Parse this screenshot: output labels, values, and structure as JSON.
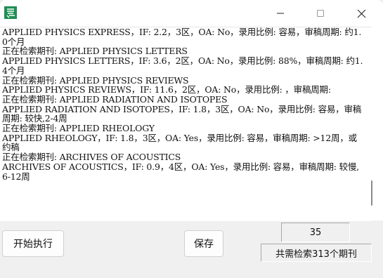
{
  "window": {
    "icon": "app-icon",
    "minimize_icon": "minimize-icon",
    "maximize_icon": "maximize-icon",
    "close_icon": "close-icon"
  },
  "log": {
    "lines": [
      "APPLIED PHYSICS EXPRESS，IF: 2.2，3区，OA: No，录用比例: 容易，审稿周期: 约1.0个月",
      "正在检索期刊: APPLIED PHYSICS LETTERS",
      "APPLIED PHYSICS LETTERS，IF: 3.6，2区，OA: No，录用比例: 88%，审稿周期: 约1.4个月",
      "正在检索期刊: APPLIED PHYSICS REVIEWS",
      "APPLIED PHYSICS REVIEWS，IF: 11.6，2区，OA: No，录用比例: ，审稿周期:",
      "正在检索期刊: APPLIED RADIATION AND ISOTOPES",
      "APPLIED RADIATION AND ISOTOPES，IF: 1.8，3区，OA: No，录用比例: 容易，审稿周期: 较快,2-4周",
      "正在检索期刊: APPLIED RHEOLOGY",
      "APPLIED RHEOLOGY，IF: 1.8，3区，OA: Yes，录用比例: 容易，审稿周期: >12周，或约稿",
      "正在检索期刊: ARCHIVES OF ACOUSTICS",
      "ARCHIVES OF ACOUSTICS，IF: 0.9，4区，OA: Yes，录用比例: 容易，审稿周期: 较慢,6-12周"
    ]
  },
  "controls": {
    "start_label": "开始执行",
    "save_label": "保存",
    "counter_value": "35",
    "total_label": "共需检索313个期刊"
  }
}
